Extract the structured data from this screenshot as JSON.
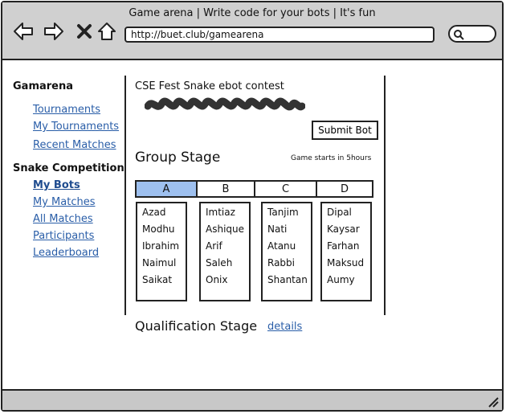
{
  "browser": {
    "title": "Game arena | Write code for your bots | It's fun",
    "url": "http://buet.club/gamearena"
  },
  "sidebar": {
    "section1": {
      "heading": "Gamarena",
      "items": [
        {
          "label": "Tournaments"
        },
        {
          "label": "My Tournaments"
        },
        {
          "label": "Recent Matches"
        }
      ]
    },
    "section2": {
      "heading": "Snake Competition",
      "items": [
        {
          "label": "My Bots",
          "active": true
        },
        {
          "label": "My Matches"
        },
        {
          "label": "All Matches"
        },
        {
          "label": "Participants"
        },
        {
          "label": "Leaderboard"
        }
      ]
    }
  },
  "main": {
    "contest_title": "CSE Fest Snake ebot contest",
    "submit_label": "Submit Bot",
    "group_stage_heading": "Group Stage",
    "game_info": "Game starts in 5hours",
    "groups": [
      {
        "tab": "A",
        "members": [
          "Azad",
          "Modhu",
          "Ibrahim",
          "Naimul",
          "Saikat"
        ]
      },
      {
        "tab": "B",
        "members": [
          "Imtiaz",
          "Ashique",
          "Arif",
          "Saleh",
          "Onix"
        ]
      },
      {
        "tab": "C",
        "members": [
          "Tanjim",
          "Nati",
          "Atanu",
          "Rabbi",
          "Shantan"
        ]
      },
      {
        "tab": "D",
        "members": [
          "Dipal",
          "Kaysar",
          "Farhan",
          "Maksud",
          "Aumy"
        ]
      }
    ],
    "selected_group": "A",
    "qualification_heading": "Qualification Stage",
    "details_label": "details"
  },
  "colors": {
    "chrome": "#d0d0d0",
    "link": "#2a5ea8",
    "selected_tab": "#9ec0ef"
  }
}
